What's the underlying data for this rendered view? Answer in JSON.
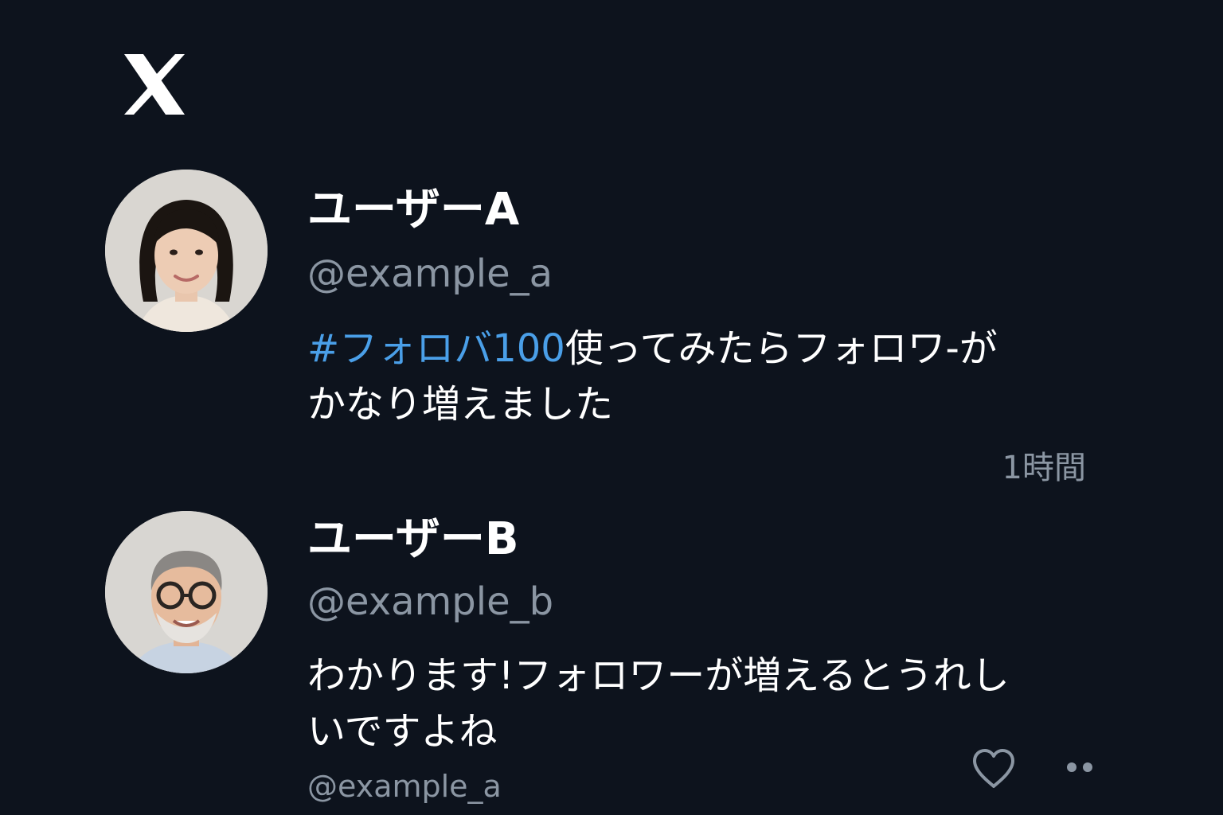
{
  "app": {
    "logo_icon": "x-logo-icon"
  },
  "posts": [
    {
      "display_name": "ユーザーA",
      "handle": "@example_a",
      "hashtag": "#フォロバ100",
      "text_line1": "使ってみたらフォロワ-が",
      "text_line2": "かなり増えました",
      "timestamp": "1時間"
    },
    {
      "display_name": "ユーザーB",
      "handle": "@example_b",
      "text_line1": "わかります!フォロワーが増えるとうれし",
      "text_line2": "いですよね",
      "reply_handle": "@example_a",
      "actions": {
        "like_icon": "heart-icon",
        "more_icon": "more-dots-icon"
      }
    }
  ],
  "colors": {
    "background": "#0d131d",
    "text": "#ffffff",
    "muted": "#8b96a3",
    "hashtag": "#4a9fe8"
  }
}
